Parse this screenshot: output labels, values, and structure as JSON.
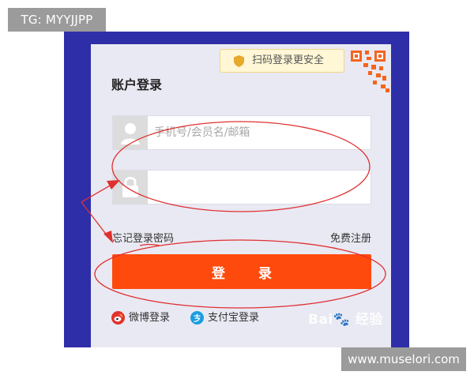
{
  "overlay": {
    "top_left_tag": "TG: MYYJJPP",
    "bottom_right_url": "www.muselori.com",
    "baidu_watermark": "Bai🐾 经验"
  },
  "login": {
    "qr_tip": "扫码登录更安全",
    "title": "账户登录",
    "username_placeholder": "手机号/会员名/邮箱",
    "password_value": "",
    "forgot_password": "忘记登录密码",
    "register": "免费注册",
    "login_button": "登 录",
    "weibo_login": "微博登录",
    "alipay_login": "支付宝登录"
  },
  "colors": {
    "frame_blue": "#2e2ea8",
    "panel_bg": "#e9e9f3",
    "login_orange": "#ff4a0d",
    "annotation_red": "#e03030",
    "weibo_red": "#e0332b",
    "alipay_blue": "#1a9de0"
  },
  "icons": [
    "shield-icon",
    "qr-code-icon",
    "user-icon",
    "lock-icon",
    "weibo-icon",
    "alipay-icon"
  ]
}
